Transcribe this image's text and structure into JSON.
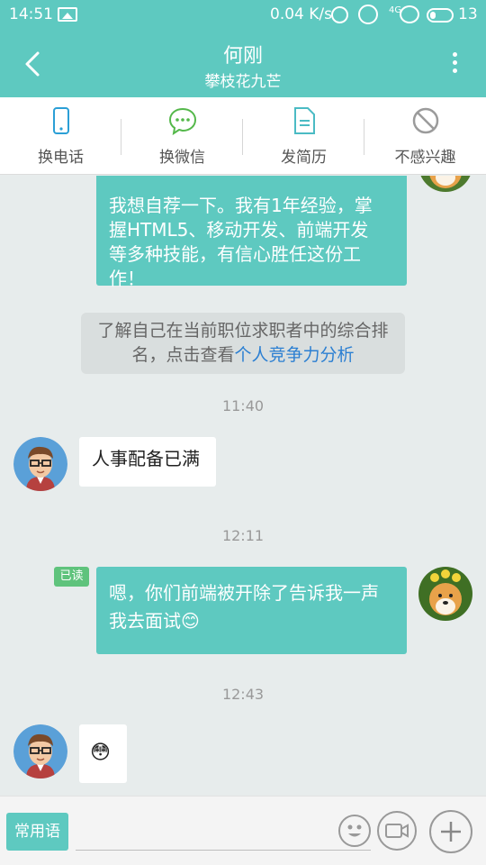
{
  "status": {
    "time": "14:51",
    "speed": "0.04 K/s",
    "network": "4G",
    "battery": "13"
  },
  "header": {
    "name": "何刚",
    "subtitle": "攀枝花九芒"
  },
  "actions": [
    {
      "label": "换电话",
      "icon": "phone-icon"
    },
    {
      "label": "换微信",
      "icon": "wechat-icon"
    },
    {
      "label": "发简历",
      "icon": "resume-icon"
    },
    {
      "label": "不感兴趣",
      "icon": "not-interested-icon"
    }
  ],
  "messages": {
    "m1_cut": "我想自荐一下。我有1年经验，掌",
    "m1_l2": "握HTML5、移动开发、前端开发",
    "m1_l3": "等多种技能，有信心胜任这份工",
    "m1_l4": "作！",
    "note_prefix": "了解自己在当前职位求职者中的综合排名，点击查看",
    "note_link": "个人竞争力分析",
    "t1": "11:40",
    "m2": "人事配备已满",
    "t2": "12:11",
    "read": "已读",
    "m3_l1": "嗯，你们前端被开除了告诉我一声",
    "m3_l2": "我去面试",
    "t3": "12:43",
    "m4_emoji": "😳",
    "m3_emoji": "😊"
  },
  "inputbar": {
    "quick_label": "常用语"
  },
  "colors": {
    "accent": "#5ec9c0",
    "read_badge": "#5fc37c",
    "link": "#2b7fd2"
  }
}
